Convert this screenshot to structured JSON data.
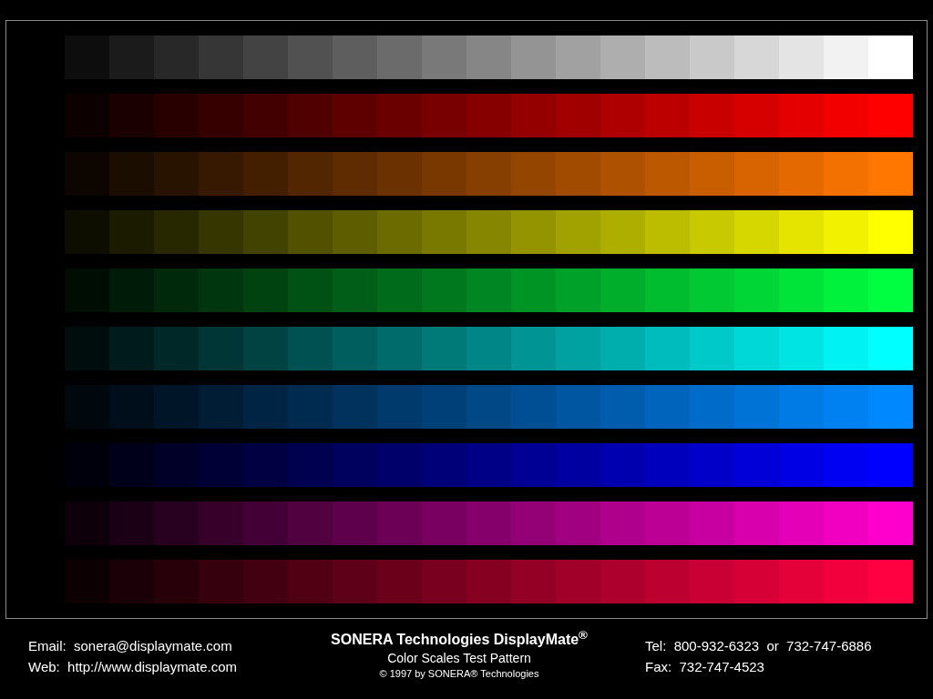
{
  "rows": [
    {
      "swatches": [
        {
          "color": "#0d0d0d"
        },
        {
          "color": "#1b1b1b"
        },
        {
          "color": "#282828"
        },
        {
          "color": "#363636"
        },
        {
          "color": "#434343"
        },
        {
          "color": "#515151"
        },
        {
          "color": "#5e5e5e"
        },
        {
          "color": "#6b6b6b"
        },
        {
          "color": "#797979"
        },
        {
          "color": "#868686"
        },
        {
          "color": "#949494"
        },
        {
          "color": "#a1a1a1"
        },
        {
          "color": "#aeaeae"
        },
        {
          "color": "#bcbcbc"
        },
        {
          "color": "#c9c9c9"
        },
        {
          "color": "#d7d7d7"
        },
        {
          "color": "#e4e4e4"
        },
        {
          "color": "#f2f2f2"
        },
        {
          "color": "#ffffff"
        }
      ]
    },
    {
      "swatches": [
        {
          "color": "#0d0000"
        },
        {
          "color": "#1b0000"
        },
        {
          "color": "#280000"
        },
        {
          "color": "#360000"
        },
        {
          "color": "#430000"
        },
        {
          "color": "#510000"
        },
        {
          "color": "#5e0000"
        },
        {
          "color": "#6b0000"
        },
        {
          "color": "#790000"
        },
        {
          "color": "#860000"
        },
        {
          "color": "#940000"
        },
        {
          "color": "#a10000"
        },
        {
          "color": "#ae0000"
        },
        {
          "color": "#bc0000"
        },
        {
          "color": "#c90000"
        },
        {
          "color": "#d70000"
        },
        {
          "color": "#e40000"
        },
        {
          "color": "#f20000"
        },
        {
          "color": "#ff0000"
        }
      ]
    },
    {
      "swatches": [
        {
          "color": "#0d0600"
        },
        {
          "color": "#1b0d00"
        },
        {
          "color": "#281300"
        },
        {
          "color": "#361900"
        },
        {
          "color": "#431f00"
        },
        {
          "color": "#512600"
        },
        {
          "color": "#5e2c00"
        },
        {
          "color": "#6b3200"
        },
        {
          "color": "#793800"
        },
        {
          "color": "#863f00"
        },
        {
          "color": "#944500"
        },
        {
          "color": "#a14b00"
        },
        {
          "color": "#ae5100"
        },
        {
          "color": "#bc5800"
        },
        {
          "color": "#c95e00"
        },
        {
          "color": "#d76400"
        },
        {
          "color": "#e46a00"
        },
        {
          "color": "#f27100"
        },
        {
          "color": "#ff7700"
        }
      ]
    },
    {
      "swatches": [
        {
          "color": "#0d0d00"
        },
        {
          "color": "#1b1b00"
        },
        {
          "color": "#282800"
        },
        {
          "color": "#363600"
        },
        {
          "color": "#434300"
        },
        {
          "color": "#515100"
        },
        {
          "color": "#5e5e00"
        },
        {
          "color": "#6b6b00"
        },
        {
          "color": "#797900"
        },
        {
          "color": "#868600"
        },
        {
          "color": "#949400"
        },
        {
          "color": "#a1a100"
        },
        {
          "color": "#aeae00"
        },
        {
          "color": "#bcbc00"
        },
        {
          "color": "#c9c900"
        },
        {
          "color": "#d7d700"
        },
        {
          "color": "#e4e400"
        },
        {
          "color": "#f2f200"
        },
        {
          "color": "#ffff00"
        }
      ]
    },
    {
      "swatches": [
        {
          "color": "#000d03"
        },
        {
          "color": "#001b07"
        },
        {
          "color": "#00280a"
        },
        {
          "color": "#00360d"
        },
        {
          "color": "#004311"
        },
        {
          "color": "#005114"
        },
        {
          "color": "#005e18"
        },
        {
          "color": "#006b1b"
        },
        {
          "color": "#00791e"
        },
        {
          "color": "#008622"
        },
        {
          "color": "#009425"
        },
        {
          "color": "#00a128"
        },
        {
          "color": "#00ae2c"
        },
        {
          "color": "#00bc2f"
        },
        {
          "color": "#00c933"
        },
        {
          "color": "#00d736"
        },
        {
          "color": "#00e439"
        },
        {
          "color": "#00f23d"
        },
        {
          "color": "#00ff40"
        }
      ]
    },
    {
      "swatches": [
        {
          "color": "#000d0d"
        },
        {
          "color": "#001b1b"
        },
        {
          "color": "#002828"
        },
        {
          "color": "#003636"
        },
        {
          "color": "#004343"
        },
        {
          "color": "#005151"
        },
        {
          "color": "#005e5e"
        },
        {
          "color": "#006b6b"
        },
        {
          "color": "#007979"
        },
        {
          "color": "#008686"
        },
        {
          "color": "#009494"
        },
        {
          "color": "#00a1a1"
        },
        {
          "color": "#00aeae"
        },
        {
          "color": "#00bcbc"
        },
        {
          "color": "#00c9c9"
        },
        {
          "color": "#00d7d7"
        },
        {
          "color": "#00e4e4"
        },
        {
          "color": "#00f2f2"
        },
        {
          "color": "#00ffff"
        }
      ]
    },
    {
      "swatches": [
        {
          "color": "#00070d"
        },
        {
          "color": "#000e1b"
        },
        {
          "color": "#001528"
        },
        {
          "color": "#001d36"
        },
        {
          "color": "#002443"
        },
        {
          "color": "#002b51"
        },
        {
          "color": "#00325e"
        },
        {
          "color": "#00396b"
        },
        {
          "color": "#004079"
        },
        {
          "color": "#004886"
        },
        {
          "color": "#004f94"
        },
        {
          "color": "#0056a1"
        },
        {
          "color": "#005dae"
        },
        {
          "color": "#0064bc"
        },
        {
          "color": "#006bc9"
        },
        {
          "color": "#0073d7"
        },
        {
          "color": "#007ae4"
        },
        {
          "color": "#0081f2"
        },
        {
          "color": "#0088ff"
        }
      ]
    },
    {
      "swatches": [
        {
          "color": "#00000d"
        },
        {
          "color": "#00001b"
        },
        {
          "color": "#000028"
        },
        {
          "color": "#000036"
        },
        {
          "color": "#000043"
        },
        {
          "color": "#000051"
        },
        {
          "color": "#00005e"
        },
        {
          "color": "#00006b"
        },
        {
          "color": "#000079"
        },
        {
          "color": "#000086"
        },
        {
          "color": "#000094"
        },
        {
          "color": "#0000a1"
        },
        {
          "color": "#0000ae"
        },
        {
          "color": "#0000bc"
        },
        {
          "color": "#0000c9"
        },
        {
          "color": "#0000d7"
        },
        {
          "color": "#0000e4"
        },
        {
          "color": "#0000f2"
        },
        {
          "color": "#0000ff"
        }
      ]
    },
    {
      "swatches": [
        {
          "color": "#0d000b"
        },
        {
          "color": "#1b0015"
        },
        {
          "color": "#280020"
        },
        {
          "color": "#36002b"
        },
        {
          "color": "#430036"
        },
        {
          "color": "#510040"
        },
        {
          "color": "#5e004b"
        },
        {
          "color": "#6b0056"
        },
        {
          "color": "#790061"
        },
        {
          "color": "#86006b"
        },
        {
          "color": "#940076"
        },
        {
          "color": "#a10081"
        },
        {
          "color": "#ae008c"
        },
        {
          "color": "#bc0096"
        },
        {
          "color": "#c900a1"
        },
        {
          "color": "#d700ac"
        },
        {
          "color": "#e400b7"
        },
        {
          "color": "#f200c1"
        },
        {
          "color": "#ff00cc"
        }
      ]
    },
    {
      "swatches": [
        {
          "color": "#0d0003"
        },
        {
          "color": "#1b0007"
        },
        {
          "color": "#28000a"
        },
        {
          "color": "#36000d"
        },
        {
          "color": "#430011"
        },
        {
          "color": "#510014"
        },
        {
          "color": "#5e0018"
        },
        {
          "color": "#6b001b"
        },
        {
          "color": "#79001e"
        },
        {
          "color": "#860022"
        },
        {
          "color": "#940025"
        },
        {
          "color": "#a10028"
        },
        {
          "color": "#ae002c"
        },
        {
          "color": "#bc002f"
        },
        {
          "color": "#c90033"
        },
        {
          "color": "#d70036"
        },
        {
          "color": "#e40039"
        },
        {
          "color": "#f2003d"
        },
        {
          "color": "#ff0040"
        }
      ]
    }
  ],
  "footer": {
    "contact_left": [
      "Email:  sonera@displaymate.com",
      "Web:  http://www.displaymate.com"
    ],
    "title": "SONERA Technologies DisplayMate$^{®}$",
    "subtitle": "Color Scales Test Pattern",
    "copyright": "© 1997 by SONERA® Technologies",
    "contact_right": [
      "Tel:  800-932-6323  or  732-747-6886",
      "Fax:  732-747-4523"
    ]
  }
}
